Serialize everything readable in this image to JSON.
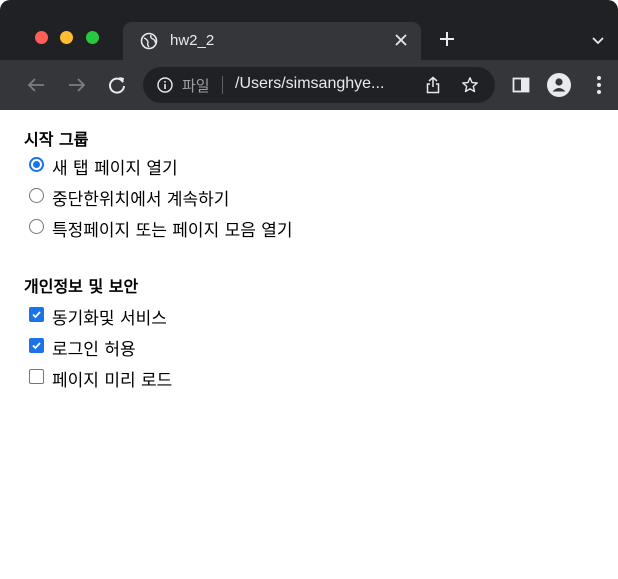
{
  "browser": {
    "tab_title": "hw2_2",
    "omnibox": {
      "scheme_label": "파일",
      "url": "/Users/simsanghye..."
    }
  },
  "page": {
    "startup": {
      "heading": "시작 그룹",
      "options": [
        {
          "label": "새 탭 페이지 열기",
          "checked": true
        },
        {
          "label": "중단한위치에서 계속하기",
          "checked": false
        },
        {
          "label": "특정페이지 또는 페이지 모음 열기",
          "checked": false
        }
      ]
    },
    "privacy": {
      "heading": "개인정보 및 보안",
      "options": [
        {
          "label": "동기화및 서비스",
          "checked": true
        },
        {
          "label": "로그인 허용",
          "checked": true
        },
        {
          "label": "페이지 미리 로드",
          "checked": false
        }
      ]
    }
  },
  "colors": {
    "accent": "#1a73e8",
    "chrome_dark": "#1f2124",
    "toolbar": "#35363a"
  }
}
